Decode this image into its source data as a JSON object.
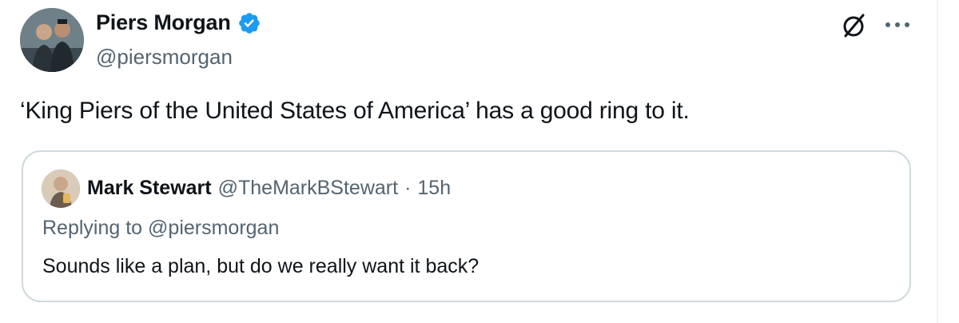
{
  "author": {
    "name": "Piers Morgan",
    "handle": "@piersmorgan",
    "verified": true
  },
  "tweet": {
    "text": "‘King Piers of the United States of America’ has a good ring to it."
  },
  "quoted_tweet": {
    "name": "Mark Stewart",
    "handle": "@TheMarkBStewart",
    "separator": "·",
    "time": "15h",
    "replying_to_prefix": "Replying to ",
    "replying_to_handle": "@piersmorgan",
    "text": "Sounds like a plan, but do we really want it back?"
  },
  "icons": {
    "verified": "verified-badge-icon",
    "grok": "grok-icon",
    "more": "more-icon"
  },
  "colors": {
    "primary_text": "#0f1419",
    "secondary_text": "#536471",
    "verified_blue": "#1d9bf0",
    "border": "#cfd9de"
  }
}
